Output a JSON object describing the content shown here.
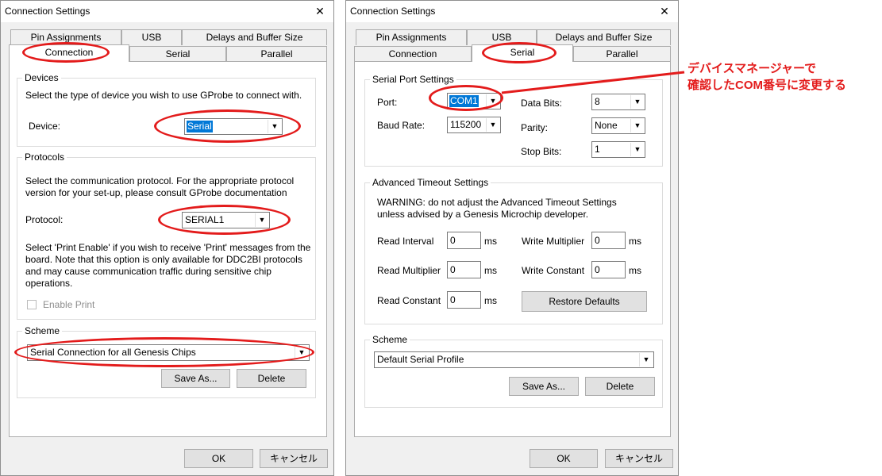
{
  "left_dialog": {
    "title": "Connection Settings",
    "close_glyph": "✕",
    "tabs_row1": [
      "Pin Assignments",
      "USB",
      "Delays and Buffer Size"
    ],
    "tabs_row2": [
      "Connection",
      "Serial",
      "Parallel"
    ],
    "active_tab": "Connection",
    "devices": {
      "legend": "Devices",
      "description": "Select the type of device you wish to use GProbe to connect with.",
      "device_label": "Device:",
      "device_value": "Serial"
    },
    "protocols": {
      "legend": "Protocols",
      "description_line1": "Select the communication protocol.  For the appropriate protocol",
      "description_line2": "version for your set-up, please consult GProbe documentation",
      "protocol_label": "Protocol:",
      "protocol_value": "SERIAL1",
      "print_line1": "Select 'Print Enable' if you wish to receive 'Print' messages from the",
      "print_line2": "board.   Note that this option is only available for DDC2BI protocols",
      "print_line3": "and may cause communication traffic during sensitive chip",
      "print_line4": "operations.",
      "enable_print_label": "Enable Print"
    },
    "scheme": {
      "legend": "Scheme",
      "value": "Serial Connection for all Genesis Chips",
      "save_as": "Save As...",
      "delete": "Delete"
    },
    "ok": "OK",
    "cancel": "キャンセル"
  },
  "right_dialog": {
    "title": "Connection Settings",
    "close_glyph": "✕",
    "tabs_row1": [
      "Pin Assignments",
      "USB",
      "Delays and Buffer Size"
    ],
    "tabs_row2": [
      "Connection",
      "Serial",
      "Parallel"
    ],
    "active_tab": "Serial",
    "serial_port": {
      "legend": "Serial Port Settings",
      "port_label": "Port:",
      "port_value": "COM1",
      "baud_label": "Baud Rate:",
      "baud_value": "115200",
      "data_bits_label": "Data Bits:",
      "data_bits_value": "8",
      "parity_label": "Parity:",
      "parity_value": "None",
      "stop_bits_label": "Stop Bits:",
      "stop_bits_value": "1"
    },
    "timeout": {
      "legend": "Advanced Timeout Settings",
      "warning_line1": "WARNING: do not adjust the Advanced Timeout Settings",
      "warning_line2": "unless advised by a Genesis Microchip developer.",
      "read_interval_label": "Read Interval",
      "read_interval_value": "0",
      "read_multiplier_label": "Read Multiplier",
      "read_multiplier_value": "0",
      "read_constant_label": "Read Constant",
      "read_constant_value": "0",
      "write_multiplier_label": "Write Multiplier",
      "write_multiplier_value": "0",
      "write_constant_label": "Write Constant",
      "write_constant_value": "0",
      "unit": "ms",
      "restore_defaults": "Restore Defaults"
    },
    "scheme": {
      "legend": "Scheme",
      "value": "Default Serial Profile",
      "save_as": "Save As...",
      "delete": "Delete"
    },
    "ok": "OK",
    "cancel": "キャンセル"
  },
  "annotation": {
    "line1": "デバイスマネージャーで",
    "line2": "確認したCOM番号に変更する",
    "color": "#e31b1b"
  }
}
